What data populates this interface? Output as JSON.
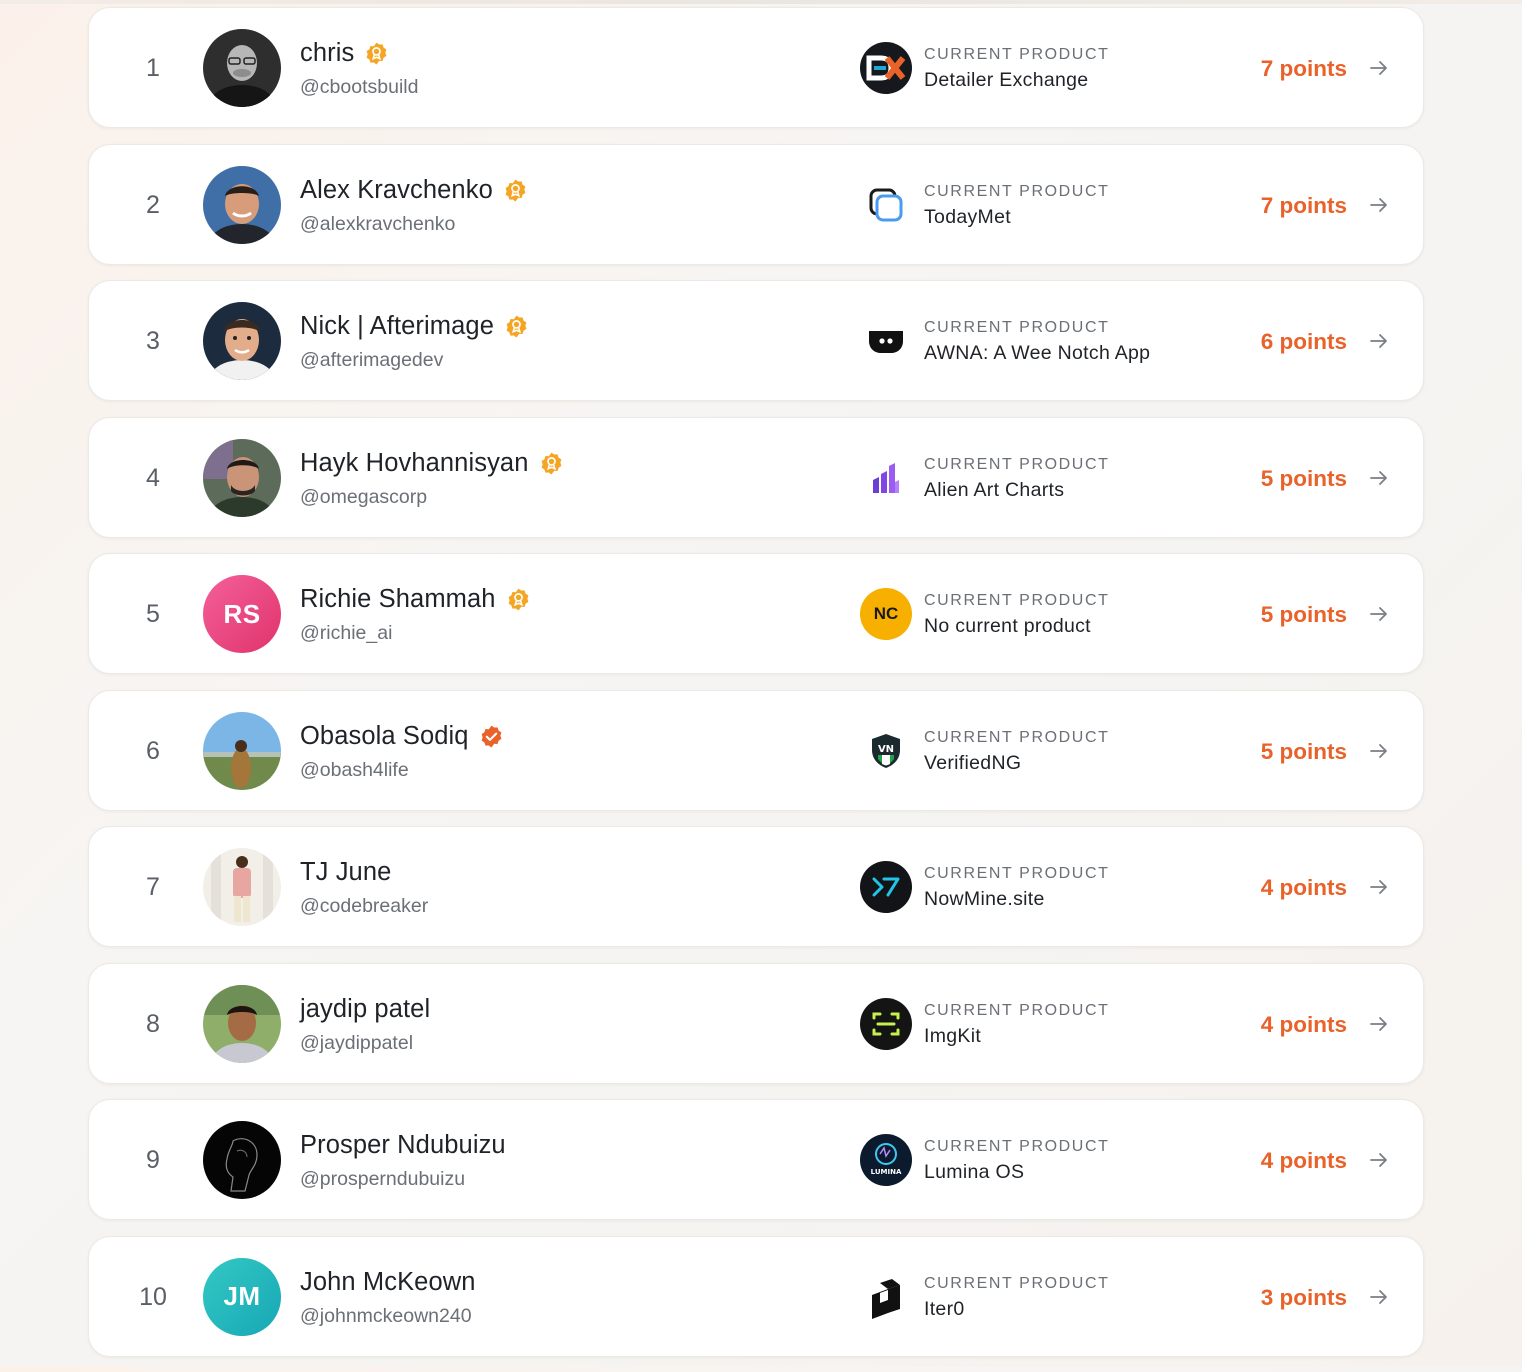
{
  "product_label": "CURRENT PRODUCT",
  "arrow_icon": "arrow-right-icon",
  "colors": {
    "points": "#e8622a",
    "gold_badge": "#f5a524",
    "verified_badge": "#e8622a"
  },
  "leaderboard": [
    {
      "rank": "1",
      "name": "chris",
      "handle": "@cbootsbuild",
      "badge": "gold-badge-icon",
      "avatar": {
        "type": "photo",
        "icon": "user-avatar-photo"
      },
      "product": {
        "name": "Detailer Exchange",
        "icon": "detailer-exchange-logo-icon"
      },
      "points": "7 points"
    },
    {
      "rank": "2",
      "name": "Alex Kravchenko",
      "handle": "@alexkravchenko",
      "badge": "gold-badge-icon",
      "avatar": {
        "type": "photo",
        "icon": "user-avatar-photo"
      },
      "product": {
        "name": "TodayMet",
        "icon": "todaymet-logo-icon"
      },
      "points": "7 points"
    },
    {
      "rank": "3",
      "name": "Nick | Afterimage",
      "handle": "@afterimagedev",
      "badge": "gold-badge-icon",
      "avatar": {
        "type": "photo",
        "icon": "user-avatar-photo"
      },
      "product": {
        "name": "AWNA: A Wee Notch App",
        "icon": "awna-logo-icon"
      },
      "points": "6 points"
    },
    {
      "rank": "4",
      "name": "Hayk Hovhannisyan",
      "handle": "@omegascorp",
      "badge": "gold-badge-icon",
      "avatar": {
        "type": "photo",
        "icon": "user-avatar-photo"
      },
      "product": {
        "name": "Alien Art Charts",
        "icon": "alien-art-charts-logo-icon"
      },
      "points": "5 points"
    },
    {
      "rank": "5",
      "name": "Richie Shammah",
      "handle": "@richie_ai",
      "badge": "gold-badge-icon",
      "avatar": {
        "type": "initials",
        "text": "RS",
        "color": "#e9407a"
      },
      "product": {
        "name": "No current product",
        "icon": "initials-logo-icon",
        "initials": "NC"
      },
      "points": "5 points"
    },
    {
      "rank": "6",
      "name": "Obasola Sodiq",
      "handle": "@obash4life",
      "badge": "verified-badge-icon",
      "avatar": {
        "type": "photo",
        "icon": "user-avatar-photo"
      },
      "product": {
        "name": "VerifiedNG",
        "icon": "verifiedng-logo-icon"
      },
      "points": "5 points"
    },
    {
      "rank": "7",
      "name": "TJ June",
      "handle": "@codebreaker",
      "badge": "",
      "avatar": {
        "type": "photo",
        "icon": "user-avatar-photo"
      },
      "product": {
        "name": "NowMine.site",
        "icon": "nowmine-logo-icon"
      },
      "points": "4 points"
    },
    {
      "rank": "8",
      "name": "jaydip patel",
      "handle": "@jaydippatel",
      "badge": "",
      "avatar": {
        "type": "photo",
        "icon": "user-avatar-photo"
      },
      "product": {
        "name": "ImgKit",
        "icon": "imgkit-logo-icon"
      },
      "points": "4 points"
    },
    {
      "rank": "9",
      "name": "Prosper Ndubuizu",
      "handle": "@prosperndubuizu",
      "badge": "",
      "avatar": {
        "type": "photo",
        "icon": "user-avatar-photo"
      },
      "product": {
        "name": "Lumina OS",
        "icon": "lumina-os-logo-icon",
        "logo_text": "LUMINA"
      },
      "points": "4 points"
    },
    {
      "rank": "10",
      "name": "John McKeown",
      "handle": "@johnmckeown240",
      "badge": "",
      "avatar": {
        "type": "initials",
        "text": "JM",
        "color": "#1fb3b8"
      },
      "product": {
        "name": "Iter0",
        "icon": "iter0-logo-icon"
      },
      "points": "3 points"
    }
  ]
}
